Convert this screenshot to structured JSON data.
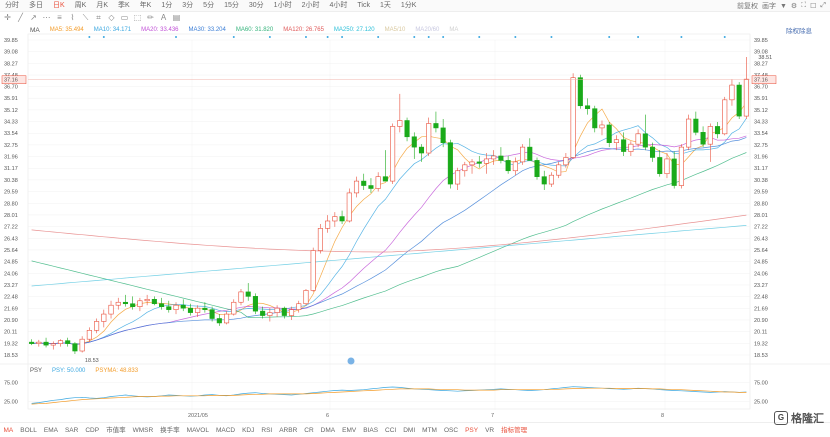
{
  "periods": [
    "分时",
    "多日",
    "日K",
    "周K",
    "月K",
    "季K",
    "年K",
    "1分",
    "3分",
    "5分",
    "15分",
    "30分",
    "1小时",
    "2小时",
    "4小时",
    "Tick",
    "1天",
    "1分K"
  ],
  "active_period": "日K",
  "prefix_label": "前复权",
  "right_controls": [
    "画字",
    "▼",
    "⚙",
    "⛶",
    "☐",
    "⤢"
  ],
  "tools": [
    "✛",
    "╱",
    "↗",
    "⋯",
    "≡",
    "⌇",
    "⟍",
    "⌗",
    "◇",
    "▭",
    "⬚",
    "✏",
    "A",
    "▤"
  ],
  "ma_legend": {
    "name": "MA",
    "items": [
      {
        "label": "MA5: 35.494",
        "color": "#f39c2a"
      },
      {
        "label": "MA10: 34.171",
        "color": "#3aa7e0"
      },
      {
        "label": "MA20: 33.436",
        "color": "#c04fd6"
      },
      {
        "label": "MA30: 33.204",
        "color": "#3b7ed6"
      },
      {
        "label": "MA60: 31.820",
        "color": "#34b37b"
      },
      {
        "label": "MA120: 26.765",
        "color": "#e05a5a"
      },
      {
        "label": "MA250: 27.120",
        "color": "#2bbfd8"
      },
      {
        "label": "MA5/10",
        "color": "#d9c9a0"
      },
      {
        "label": "MA20/60",
        "color": "#c8c8e0"
      },
      {
        "label": "MA",
        "color": "#d0d0d0"
      }
    ]
  },
  "period_fix_label": "除权除息",
  "psy_legend": {
    "name": "PSY",
    "items": [
      {
        "label": "PSY: 50.000",
        "color": "#3aa7e0"
      },
      {
        "label": "PSYMA: 48.833",
        "color": "#f39c2a"
      }
    ]
  },
  "indicator_tabs": [
    "MA",
    "BOLL",
    "EMA",
    "SAR",
    "CDP",
    "市值率",
    "WMSR",
    "换手率",
    "MAVOL",
    "MACD",
    "KDJ",
    "RSI",
    "ARBR",
    "CR",
    "DMA",
    "EMV",
    "BIAS",
    "CCI",
    "DMI",
    "MTM",
    "OSC",
    "PSY",
    "VR",
    "指标管理"
  ],
  "active_main_tab": "MA",
  "active_sub_tab": "PSY",
  "logo_text": "格隆汇",
  "price_axis": [
    "39.85",
    "39.08",
    "38.27",
    "37.48",
    "36.70",
    "35.91",
    "35.12",
    "34.33",
    "33.54",
    "32.75",
    "31.96",
    "31.17",
    "30.38",
    "29.59",
    "28.80",
    "28.01",
    "27.22",
    "26.43",
    "25.64",
    "24.85",
    "24.06",
    "23.27",
    "22.48",
    "21.69",
    "20.90",
    "20.11",
    "19.32",
    "18.53"
  ],
  "current_price_label": "37.16",
  "high_label": "38.51",
  "low_label": "18.53",
  "psy_axis": [
    "75.00",
    "25.00"
  ],
  "date_labels": [
    "2021/05",
    "6",
    "7",
    "8"
  ],
  "colors": {
    "up": "#e9503c",
    "down": "#1aaa1a",
    "accent": "#e9503c"
  },
  "chart_data": {
    "type": "candlestick",
    "note_labels": [],
    "ohlc": [
      [
        19.4,
        19.6,
        19.2,
        19.3
      ],
      [
        19.3,
        19.55,
        19.1,
        19.4
      ],
      [
        19.4,
        19.7,
        19.05,
        19.2
      ],
      [
        19.2,
        19.45,
        18.9,
        19.3
      ],
      [
        19.3,
        19.6,
        19.1,
        19.5
      ],
      [
        19.5,
        19.7,
        19.1,
        19.3
      ],
      [
        19.3,
        19.4,
        18.6,
        18.8
      ],
      [
        18.8,
        19.8,
        18.7,
        19.6
      ],
      [
        19.6,
        20.4,
        19.4,
        20.2
      ],
      [
        20.2,
        21.0,
        20.0,
        20.8
      ],
      [
        20.8,
        21.6,
        20.4,
        21.3
      ],
      [
        21.3,
        22.2,
        21.0,
        21.9
      ],
      [
        21.9,
        22.4,
        21.6,
        22.1
      ],
      [
        22.1,
        22.6,
        21.8,
        22.0
      ],
      [
        22.0,
        22.5,
        21.6,
        21.8
      ],
      [
        21.8,
        22.4,
        21.5,
        22.2
      ],
      [
        22.2,
        22.6,
        21.9,
        22.3
      ],
      [
        22.3,
        22.5,
        21.9,
        22.0
      ],
      [
        22.0,
        22.4,
        21.6,
        21.8
      ],
      [
        21.8,
        22.2,
        21.4,
        21.6
      ],
      [
        21.6,
        22.1,
        21.3,
        21.9
      ],
      [
        21.9,
        22.3,
        21.5,
        21.7
      ],
      [
        21.7,
        22.0,
        21.2,
        21.4
      ],
      [
        21.4,
        21.9,
        21.1,
        21.7
      ],
      [
        21.7,
        22.1,
        21.4,
        21.6
      ],
      [
        21.6,
        21.8,
        20.8,
        21.0
      ],
      [
        21.0,
        21.3,
        20.5,
        20.7
      ],
      [
        20.7,
        21.5,
        20.6,
        21.3
      ],
      [
        21.3,
        22.3,
        21.2,
        22.1
      ],
      [
        22.1,
        23.0,
        21.9,
        22.8
      ],
      [
        22.8,
        23.4,
        22.2,
        22.5
      ],
      [
        22.5,
        22.7,
        21.3,
        21.5
      ],
      [
        21.5,
        21.8,
        21.0,
        21.2
      ],
      [
        21.2,
        21.7,
        20.8,
        21.4
      ],
      [
        21.4,
        21.9,
        21.1,
        21.7
      ],
      [
        21.7,
        21.8,
        21.0,
        21.2
      ],
      [
        21.2,
        21.8,
        20.9,
        21.6
      ],
      [
        21.6,
        22.2,
        21.4,
        22.0
      ],
      [
        22.0,
        23.0,
        21.9,
        22.9
      ],
      [
        22.9,
        25.8,
        22.8,
        25.6
      ],
      [
        25.6,
        27.4,
        25.4,
        27.1
      ],
      [
        27.1,
        28.0,
        26.8,
        27.6
      ],
      [
        27.6,
        28.2,
        27.2,
        27.9
      ],
      [
        27.9,
        28.3,
        27.4,
        27.6
      ],
      [
        27.6,
        29.8,
        27.5,
        29.5
      ],
      [
        29.5,
        30.6,
        29.2,
        30.3
      ],
      [
        30.3,
        30.8,
        29.7,
        30.0
      ],
      [
        30.0,
        30.5,
        29.5,
        29.8
      ],
      [
        29.8,
        30.9,
        29.6,
        30.6
      ],
      [
        30.6,
        32.4,
        30.4,
        30.3
      ],
      [
        30.3,
        34.2,
        30.1,
        34.0
      ],
      [
        34.0,
        36.2,
        33.6,
        34.4
      ],
      [
        34.4,
        34.6,
        33.0,
        33.3
      ],
      [
        33.3,
        33.6,
        31.8,
        32.6
      ],
      [
        32.6,
        32.8,
        31.6,
        32.2
      ],
      [
        32.2,
        34.6,
        32.0,
        34.2
      ],
      [
        34.2,
        35.0,
        33.6,
        33.9
      ],
      [
        33.9,
        34.5,
        32.6,
        32.9
      ],
      [
        32.9,
        33.1,
        29.8,
        30.1
      ],
      [
        30.1,
        31.2,
        29.7,
        31.0
      ],
      [
        31.0,
        31.6,
        30.6,
        31.4
      ],
      [
        31.4,
        31.8,
        30.8,
        31.6
      ],
      [
        31.6,
        32.0,
        31.2,
        31.5
      ],
      [
        31.5,
        32.2,
        30.8,
        31.8
      ],
      [
        31.8,
        32.4,
        31.4,
        32.0
      ],
      [
        32.0,
        32.6,
        31.5,
        31.7
      ],
      [
        31.7,
        32.0,
        30.8,
        31.0
      ],
      [
        31.0,
        31.9,
        30.7,
        31.6
      ],
      [
        31.6,
        32.8,
        31.4,
        32.6
      ],
      [
        32.6,
        33.2,
        32.2,
        31.7
      ],
      [
        31.7,
        31.9,
        30.4,
        30.6
      ],
      [
        30.6,
        31.0,
        29.7,
        30.1
      ],
      [
        30.1,
        30.9,
        29.9,
        30.7
      ],
      [
        30.7,
        31.6,
        30.5,
        31.4
      ],
      [
        31.4,
        32.2,
        31.2,
        31.9
      ],
      [
        31.9,
        37.6,
        31.8,
        37.3
      ],
      [
        37.3,
        37.5,
        35.2,
        35.4
      ],
      [
        35.4,
        35.9,
        34.8,
        35.2
      ],
      [
        35.2,
        35.4,
        33.6,
        33.9
      ],
      [
        33.9,
        34.4,
        33.4,
        34.1
      ],
      [
        34.1,
        34.3,
        32.6,
        32.9
      ],
      [
        32.9,
        33.4,
        32.4,
        33.1
      ],
      [
        33.1,
        33.6,
        32.0,
        32.3
      ],
      [
        32.3,
        33.0,
        32.0,
        32.8
      ],
      [
        32.8,
        33.8,
        32.6,
        33.5
      ],
      [
        33.5,
        34.8,
        32.4,
        32.6
      ],
      [
        32.6,
        32.9,
        31.6,
        31.9
      ],
      [
        31.9,
        32.4,
        30.6,
        30.8
      ],
      [
        30.8,
        32.2,
        30.5,
        31.8
      ],
      [
        31.8,
        32.3,
        29.8,
        30.0
      ],
      [
        30.0,
        32.8,
        29.8,
        32.6
      ],
      [
        32.6,
        34.8,
        32.4,
        34.5
      ],
      [
        34.5,
        35.0,
        33.4,
        33.6
      ],
      [
        33.6,
        34.0,
        32.6,
        32.8
      ],
      [
        32.8,
        34.2,
        31.6,
        34.0
      ],
      [
        34.0,
        34.3,
        33.2,
        33.5
      ],
      [
        33.5,
        36.0,
        33.4,
        35.8
      ],
      [
        35.8,
        37.2,
        35.4,
        36.8
      ],
      [
        36.8,
        37.0,
        34.5,
        34.7
      ],
      [
        34.7,
        38.7,
        34.5,
        37.2
      ]
    ],
    "psy": [
      20,
      22,
      25,
      28,
      30,
      33,
      35,
      36,
      34,
      33,
      35,
      38,
      40,
      42,
      40,
      38,
      37,
      38,
      40,
      42,
      41,
      40,
      39,
      40,
      42,
      43,
      41,
      40,
      42,
      45,
      47,
      48,
      46,
      45,
      44,
      43,
      42,
      44,
      46,
      48,
      50,
      52,
      54,
      55,
      54,
      55,
      56,
      58,
      60,
      62,
      63,
      62,
      60,
      58,
      57,
      56,
      55,
      54,
      53,
      52,
      53,
      54,
      55,
      56,
      57,
      58,
      57,
      56,
      55,
      54,
      55,
      56,
      58,
      60,
      62,
      64,
      63,
      62,
      61,
      60,
      59,
      58,
      57,
      58,
      60,
      59,
      58,
      56,
      55,
      54,
      53,
      52,
      51,
      50,
      49,
      50,
      51,
      50,
      49,
      50
    ],
    "psyma": [
      18,
      19,
      20,
      22,
      24,
      26,
      28,
      30,
      31,
      32,
      33,
      34,
      35,
      36,
      37,
      38,
      38,
      38,
      39,
      39,
      40,
      40,
      40,
      40,
      40,
      41,
      41,
      41,
      41,
      42,
      43,
      44,
      44,
      45,
      45,
      45,
      45,
      45,
      45,
      46,
      47,
      48,
      49,
      50,
      51,
      52,
      53,
      54,
      55,
      56,
      57,
      58,
      58,
      58,
      58,
      58,
      57,
      57,
      56,
      56,
      55,
      55,
      55,
      55,
      55,
      56,
      56,
      56,
      56,
      56,
      56,
      56,
      57,
      57,
      58,
      59,
      59,
      60,
      60,
      60,
      60,
      59,
      59,
      59,
      59,
      59,
      58,
      58,
      57,
      57,
      56,
      55,
      54,
      53,
      52,
      51,
      50,
      50,
      49,
      49
    ]
  }
}
